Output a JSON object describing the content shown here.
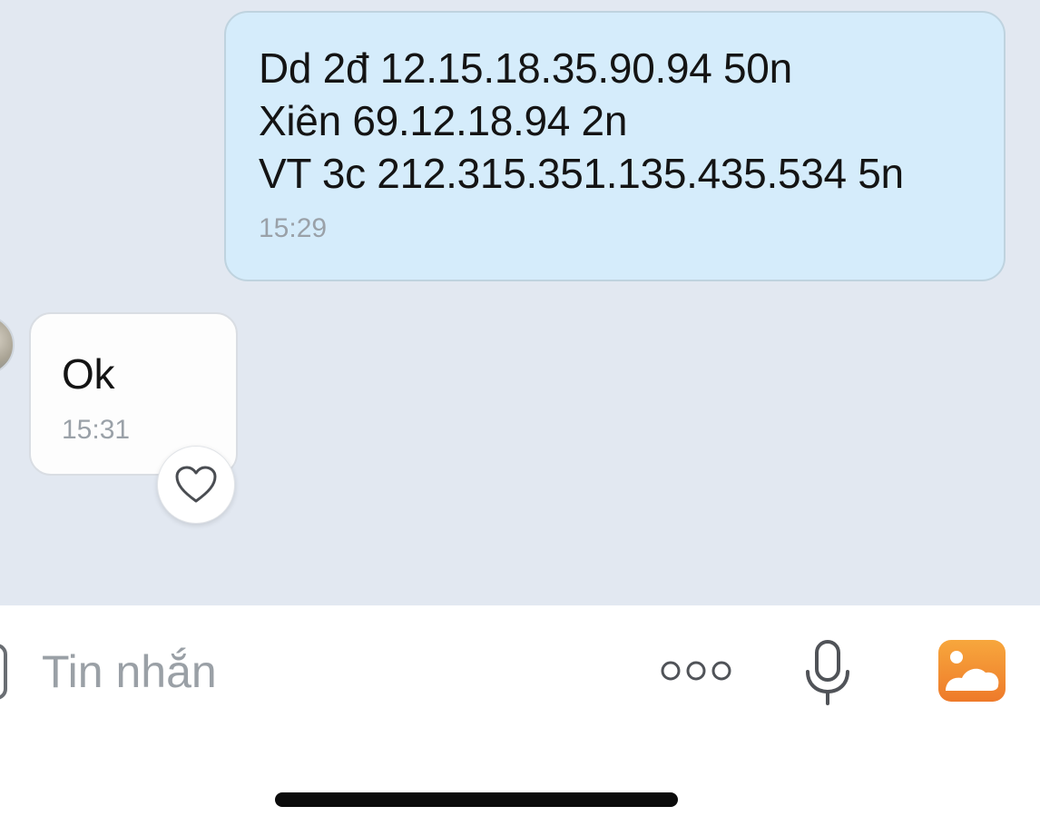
{
  "messages": {
    "outgoing": {
      "lines": [
        "Dd 2đ 12.15.18.35.90.94 50n",
        "Xiên 69.12.18.94 2n",
        "VT 3c 212.315.351.135.435.534 5n"
      ],
      "time": "15:29"
    },
    "incoming": {
      "text": "Ok",
      "time": "15:31"
    }
  },
  "composer": {
    "placeholder": "Tin nhắn",
    "value": ""
  },
  "icons": {
    "reaction": "heart-icon",
    "more": "more-dots-icon",
    "mic": "microphone-icon",
    "image": "image-gallery-icon"
  },
  "colors": {
    "chat_background": "#e2e8f1",
    "outgoing_bubble": "#d5ecfb",
    "incoming_bubble": "#fdfdfd",
    "timestamp": "#9aa1a8",
    "image_icon_accent": "#f28a2c"
  }
}
